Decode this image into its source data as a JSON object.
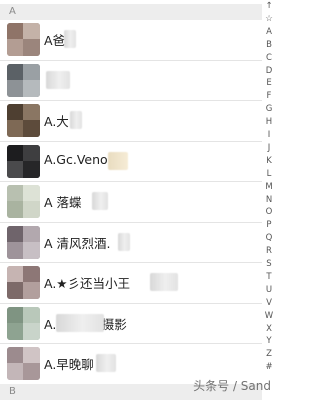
{
  "sections": [
    {
      "letter": "A"
    },
    {
      "letter": "B"
    }
  ],
  "contacts": [
    {
      "name": "A爸"
    },
    {
      "name": ""
    },
    {
      "name": "A.大"
    },
    {
      "name": "A.Gc.Veno"
    },
    {
      "name": "A 落蝶"
    },
    {
      "name": "A  清风烈酒."
    },
    {
      "name": "A.★彡还当小王"
    },
    {
      "name": "A.              也 美食摄影"
    },
    {
      "name": "A.早晚聊"
    }
  ],
  "index_bar": [
    "↑",
    "☆",
    "A",
    "B",
    "C",
    "D",
    "E",
    "F",
    "G",
    "H",
    "I",
    "J",
    "K",
    "L",
    "M",
    "N",
    "O",
    "P",
    "Q",
    "R",
    "S",
    "T",
    "U",
    "V",
    "W",
    "X",
    "Y",
    "Z",
    "#"
  ],
  "watermark": "头条号 / Sand"
}
